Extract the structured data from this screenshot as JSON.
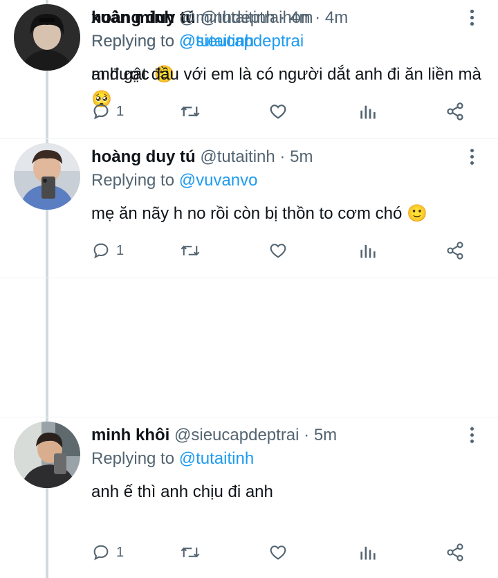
{
  "tweets": [
    {
      "name": "hoàng duy tú",
      "handle": "@tutaitinh",
      "separator": "·",
      "time": "5m",
      "replying_prefix": "Replying to",
      "replying_to": "@vuvanvo",
      "text": "mẹ ăn nãy h no rồi còn bị thồn to cơm chó 🙂",
      "reply_count": "1"
    },
    {
      "name": "minh khôi",
      "handle": "@sieucapdeptrai",
      "separator": "·",
      "time": "5m",
      "replying_prefix": "Replying to",
      "replying_to": "@tutaitinh",
      "text": "anh ế thì anh chịu đi anh",
      "reply_count": "1"
    },
    {
      "name": "hoàng duy tú",
      "handle": "@tutaitinh",
      "separator": "·",
      "time": "4m",
      "replying_prefix": "Replying to",
      "replying_to": "@sieucapdeptrai",
      "text": "m được 🙂",
      "reply_count": "1"
    },
    {
      "name": "xuân minh",
      "handle": "@minhdeptraihon",
      "separator": "·",
      "time": "4m",
      "replying_prefix": "Replying to",
      "replying_to": "@tutaitinh",
      "text": "anh gật đầu với em là có người dắt anh đi ăn liền mà 🥺",
      "reply_count": "1"
    }
  ],
  "icons": {
    "reply": "reply-icon",
    "retweet": "retweet-icon",
    "like": "heart-icon",
    "views": "views-icon",
    "share": "share-icon",
    "more": "more-vertical-icon"
  },
  "colors": {
    "name": "#0f1419",
    "secondary": "#536471",
    "link": "#1d9bf0",
    "thread_line": "#cfd9de"
  }
}
